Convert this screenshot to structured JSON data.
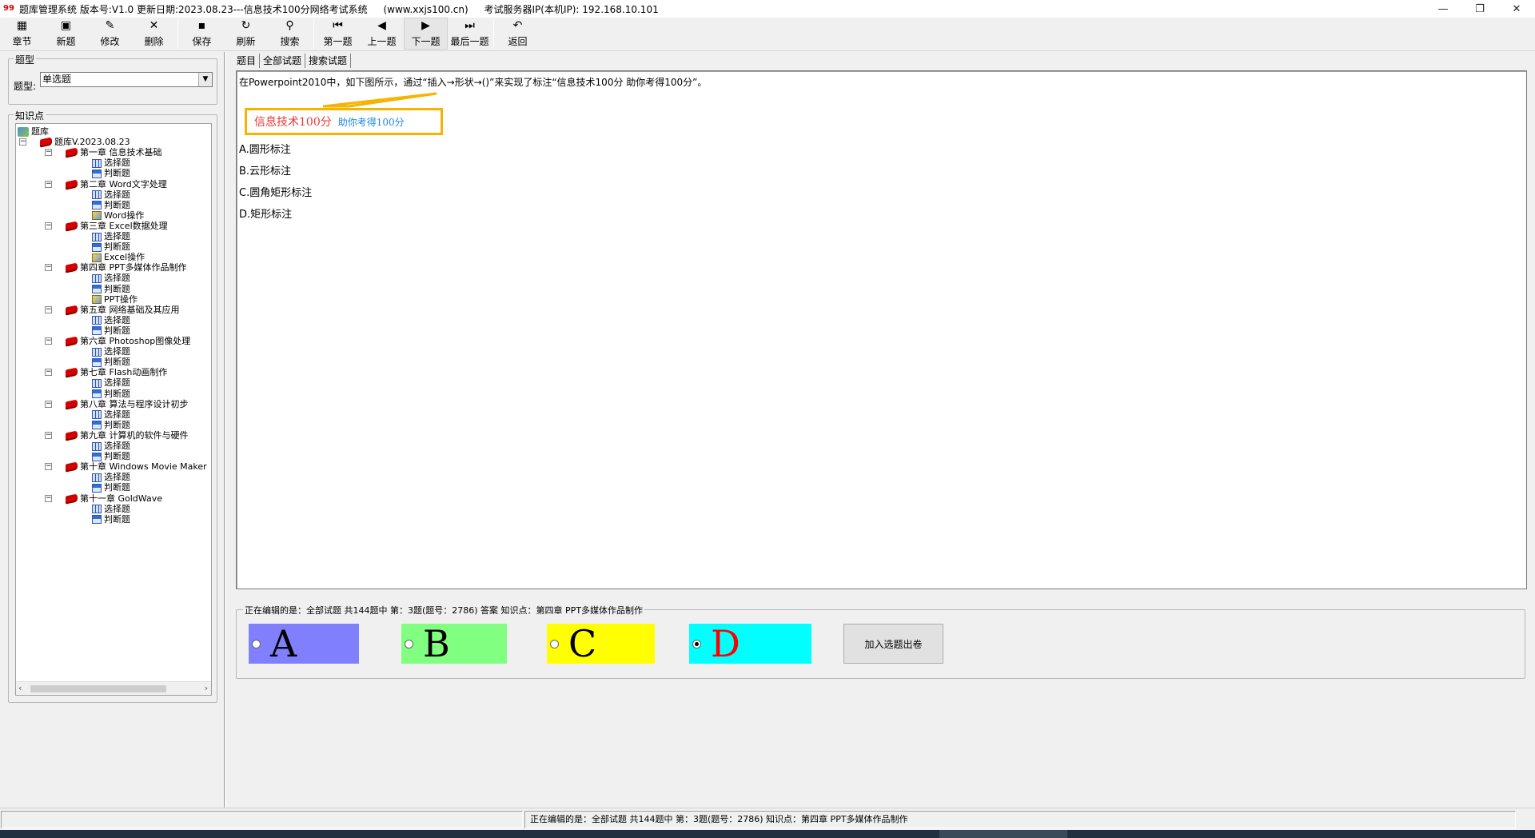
{
  "window": {
    "title_parts": [
      "题库管理系统 版本号:V1.0 更新日期:2023.08.23---信息技术100分网络考试系统",
      "(www.xxjs100.cn)",
      "考试服务器IP(本机IP): 192.168.10.101"
    ],
    "controls": {
      "minimize": "—",
      "restore": "❐",
      "close": "✕"
    }
  },
  "toolbar": [
    {
      "label": "章节",
      "icon": "chapter-icon",
      "glyph": "▦"
    },
    {
      "label": "新题",
      "icon": "new-icon",
      "glyph": "▣"
    },
    {
      "label": "修改",
      "icon": "edit-icon",
      "glyph": "✎"
    },
    {
      "label": "删除",
      "icon": "delete-icon",
      "glyph": "✕"
    },
    {
      "label": "保存",
      "icon": "save-icon",
      "glyph": "▪"
    },
    {
      "label": "刷新",
      "icon": "refresh-icon",
      "glyph": "↻"
    },
    {
      "label": "搜索",
      "icon": "search-icon",
      "glyph": "⚲"
    },
    {
      "label": "第一题",
      "icon": "first-icon",
      "glyph": "⏮"
    },
    {
      "label": "上一题",
      "icon": "prev-icon",
      "glyph": "◀"
    },
    {
      "label": "下一题",
      "icon": "next-icon",
      "glyph": "▶"
    },
    {
      "label": "最后一题",
      "icon": "last-icon",
      "glyph": "⏭"
    },
    {
      "label": "返回",
      "icon": "back-icon",
      "glyph": "↶"
    }
  ],
  "left": {
    "type_group_title": "题型",
    "type_label": "题型:",
    "type_value": "单选题",
    "kp_group_title": "知识点",
    "tree": [
      {
        "label": "题库",
        "icon": "root",
        "level": 0
      },
      {
        "label": "题库V.2023.08.23",
        "icon": "book",
        "level": 1
      },
      {
        "label": "第一章 信息技术基础",
        "icon": "book",
        "level": 2
      },
      {
        "label": "选择题",
        "icon": "grid",
        "level": 3
      },
      {
        "label": "判断题",
        "icon": "judge",
        "level": 3
      },
      {
        "label": "第二章 Word文字处理",
        "icon": "book",
        "level": 2
      },
      {
        "label": "选择题",
        "icon": "grid",
        "level": 3
      },
      {
        "label": "判断题",
        "icon": "judge",
        "level": 3
      },
      {
        "label": "Word操作",
        "icon": "op",
        "level": 3
      },
      {
        "label": "第三章 Excel数据处理",
        "icon": "book",
        "level": 2
      },
      {
        "label": "选择题",
        "icon": "grid",
        "level": 3
      },
      {
        "label": "判断题",
        "icon": "judge",
        "level": 3
      },
      {
        "label": "Excel操作",
        "icon": "op",
        "level": 3
      },
      {
        "label": "第四章 PPT多媒体作品制作",
        "icon": "book",
        "level": 2
      },
      {
        "label": "选择题",
        "icon": "grid",
        "level": 3
      },
      {
        "label": "判断题",
        "icon": "judge",
        "level": 3
      },
      {
        "label": "PPT操作",
        "icon": "op",
        "level": 3
      },
      {
        "label": "第五章 网络基础及其应用",
        "icon": "book",
        "level": 2
      },
      {
        "label": "选择题",
        "icon": "grid",
        "level": 3
      },
      {
        "label": "判断题",
        "icon": "judge",
        "level": 3
      },
      {
        "label": "第六章 Photoshop图像处理",
        "icon": "book",
        "level": 2
      },
      {
        "label": "选择题",
        "icon": "grid",
        "level": 3
      },
      {
        "label": "判断题",
        "icon": "judge",
        "level": 3
      },
      {
        "label": "第七章 Flash动画制作",
        "icon": "book",
        "level": 2
      },
      {
        "label": "选择题",
        "icon": "grid",
        "level": 3
      },
      {
        "label": "判断题",
        "icon": "judge",
        "level": 3
      },
      {
        "label": "第八章 算法与程序设计初步",
        "icon": "book",
        "level": 2
      },
      {
        "label": "选择题",
        "icon": "grid",
        "level": 3
      },
      {
        "label": "判断题",
        "icon": "judge",
        "level": 3
      },
      {
        "label": "第九章 计算机的软件与硬件",
        "icon": "book",
        "level": 2
      },
      {
        "label": "选择题",
        "icon": "grid",
        "level": 3
      },
      {
        "label": "判断题",
        "icon": "judge",
        "level": 3
      },
      {
        "label": "第十章 Windows Movie Maker",
        "icon": "book",
        "level": 2
      },
      {
        "label": "选择题",
        "icon": "grid",
        "level": 3
      },
      {
        "label": "判断题",
        "icon": "judge",
        "level": 3
      },
      {
        "label": "第十一章 GoldWave",
        "icon": "book",
        "level": 2
      },
      {
        "label": "选择题",
        "icon": "grid",
        "level": 3
      },
      {
        "label": "判断题",
        "icon": "judge",
        "level": 3
      }
    ]
  },
  "tabs": [
    "题目",
    "全部试题",
    "搜索试题"
  ],
  "question": {
    "text": "在Powerpoint2010中，如下图所示，通过“插入→形状→()”来实现了标注“信息技术100分 助你考得100分”。",
    "callout_main": "信息技术100分",
    "callout_sub": "助你考得100分",
    "options": [
      "A.圆形标注",
      "B.云形标注",
      "C.圆角矩形标注",
      "D.矩形标注"
    ]
  },
  "answer": {
    "title": "正在编辑的是：全部试题 共144题中   第：3题(题号：2786) 答案 知识点：第四章 PPT多媒体作品制作",
    "letters": [
      "A",
      "B",
      "C",
      "D"
    ],
    "selected": "D",
    "add_button": "加入选题出卷"
  },
  "status": {
    "main": "正在编辑的是：全部试题 共144题中   第：3题(题号：2786)   知识点：第四章 PPT多媒体作品制作"
  },
  "colors": {
    "a": "#8080ff",
    "b": "#80ff80",
    "c": "#ffff00",
    "d": "#00ffff",
    "d_letter": "#ff0000",
    "callout_border": "#f5b400"
  }
}
